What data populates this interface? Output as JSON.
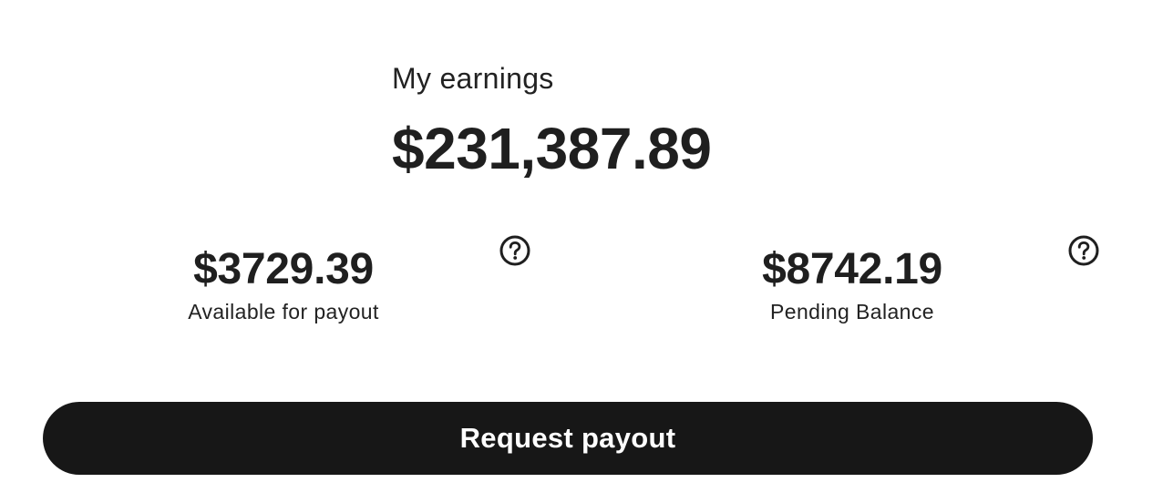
{
  "earnings": {
    "label": "My earnings",
    "total": "$231,387.89"
  },
  "stats": {
    "available": {
      "value": "$3729.39",
      "label": "Available for payout",
      "icon": "help-icon"
    },
    "pending": {
      "value": "$8742.19",
      "label": "Pending Balance",
      "icon": "help-icon"
    }
  },
  "actions": {
    "request_payout_label": "Request payout"
  },
  "colors": {
    "text": "#1f1f1f",
    "button_bg": "#171717",
    "button_text": "#ffffff",
    "background": "#ffffff"
  }
}
